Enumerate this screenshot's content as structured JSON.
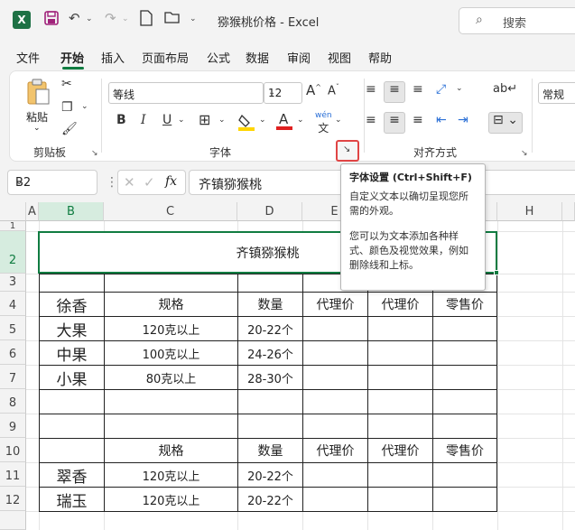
{
  "window": {
    "title": "猕猴桃价格  -  Excel",
    "search_placeholder": "搜索"
  },
  "menu": {
    "tabs": [
      "文件",
      "开始",
      "插入",
      "页面布局",
      "公式",
      "数据",
      "审阅",
      "视图",
      "帮助"
    ],
    "active": "开始"
  },
  "ribbon": {
    "clipboard": {
      "paste_label": "粘贴",
      "group_label": "剪贴板"
    },
    "font": {
      "font_name": "等线",
      "font_size": "12",
      "group_label": "字体",
      "wen_label": "wén"
    },
    "alignment": {
      "group_label": "对齐方式"
    },
    "number": {
      "format": "常规"
    }
  },
  "formula_bar": {
    "name_box": "B2",
    "fx_label": "fx",
    "content": "齐镇猕猴桃"
  },
  "sheet": {
    "columns": [
      "A",
      "B",
      "C",
      "D",
      "E",
      "F",
      "G",
      "H"
    ],
    "rows": [
      "1",
      "2",
      "3",
      "4",
      "5",
      "6",
      "7",
      "8",
      "9",
      "10",
      "11",
      "12"
    ],
    "merged_title": "齐镇猕猴桃",
    "r4": {
      "b": "徐香",
      "c": "规格",
      "d": "数量",
      "e": "代理价",
      "f": "代理价",
      "g": "零售价"
    },
    "r5": {
      "b": "大果",
      "c": "120克以上",
      "d": "20-22个"
    },
    "r6": {
      "b": "中果",
      "c": "100克以上",
      "d": "24-26个"
    },
    "r7": {
      "b": "小果",
      "c": "80克以上",
      "d": "28-30个"
    },
    "r10": {
      "c": "规格",
      "d": "数量",
      "e": "代理价",
      "f": "代理价",
      "g": "零售价"
    },
    "r11": {
      "b": "翠香",
      "c": "120克以上",
      "d": "20-22个"
    },
    "r12": {
      "b": "瑞玉",
      "c": "120克以上",
      "d": "20-22个"
    }
  },
  "tooltip": {
    "title": "字体设置 (Ctrl+Shift+F)",
    "p1": "自定义文本以确切呈现您所需的外观。",
    "p2": "您可以为文本添加各种样式、颜色及视觉效果，例如删除线和上标。"
  },
  "colors": {
    "accent": "#107c41",
    "launcher_highlight": "#e04545"
  }
}
